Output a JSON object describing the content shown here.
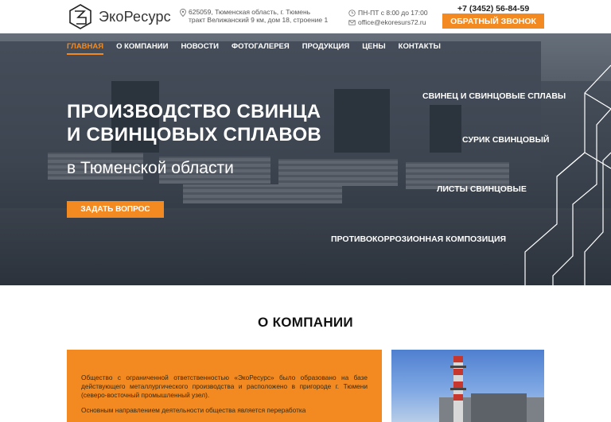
{
  "header": {
    "logo_text": "ЭкоРесурс",
    "address_line1": "625059, Тюменская область, г. Тюмень",
    "address_line2": "тракт Велижанский 9 км, дом 18, строение 1",
    "hours": "ПН-ПТ с 8:00 до 17:00",
    "email": "office@ekoresurs72.ru",
    "phone": "+7 (3452) 56-84-59",
    "callback_label": "ОБРАТНЫЙ ЗВОНОК"
  },
  "nav": {
    "items": [
      {
        "label": "ГЛАВНАЯ"
      },
      {
        "label": "О КОМПАНИИ"
      },
      {
        "label": "НОВОСТИ"
      },
      {
        "label": "ФОТОГАЛЕРЕЯ"
      },
      {
        "label": "ПРОДУКЦИЯ"
      },
      {
        "label": "ЦЕНЫ"
      },
      {
        "label": "КОНТАКТЫ"
      }
    ],
    "active_item": "ГЛАВНАЯ"
  },
  "hero": {
    "title_line1": "ПРОИЗВОДСТВО СВИНЦА",
    "title_line2": "И СВИНЦОВЫХ СПЛАВОВ",
    "subtitle": "в Тюменской области",
    "ask_button": "ЗАДАТЬ ВОПРОС",
    "products": [
      "СВИНЕЦ И СВИНЦОВЫЕ СПЛАВЫ",
      "СУРИК СВИНЦОВЫЙ",
      "ЛИСТЫ СВИНЦОВЫЕ",
      "ПРОТИВОКОРРОЗИОННАЯ КОМПОЗИЦИЯ"
    ]
  },
  "about": {
    "title": "О КОМПАНИИ",
    "paragraph1": "Общество с ограниченной ответственностью «ЭкоРесурс» было образовано на базе действующего металлургического производства и расположено в пригороде г. Тюмени (северо-восточный промышленный узел).",
    "paragraph2": "Основным направлением деятельности общества является переработка"
  },
  "colors": {
    "accent": "#f38a21",
    "text_dark": "#222222",
    "white": "#ffffff"
  },
  "icons": {
    "logo": "hexagon-logo-icon",
    "address": "map-pin-icon",
    "hours": "clock-icon",
    "email": "mail-icon"
  }
}
